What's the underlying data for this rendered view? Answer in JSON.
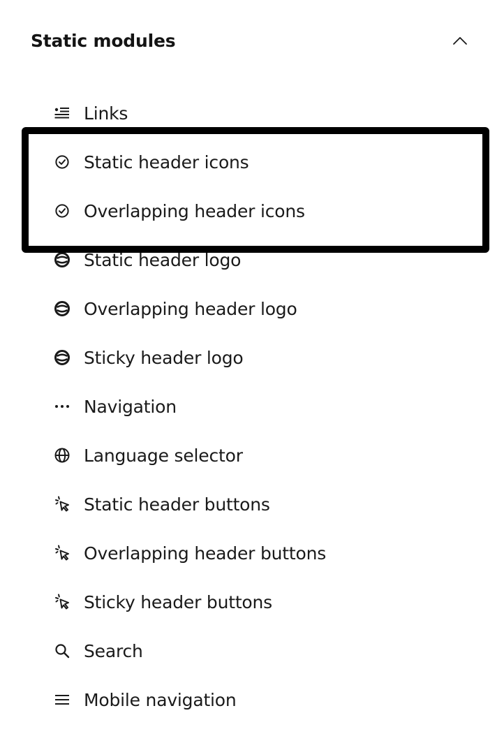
{
  "section": {
    "title": "Static modules",
    "collapse_icon": "chevron-up-icon"
  },
  "modules": [
    {
      "label": "Links",
      "icon": "links-list-icon"
    },
    {
      "label": "Static header icons",
      "icon": "check-circle-icon"
    },
    {
      "label": "Overlapping header icons",
      "icon": "check-circle-icon"
    },
    {
      "label": "Static header logo",
      "icon": "logo-icon"
    },
    {
      "label": "Overlapping header logo",
      "icon": "logo-icon"
    },
    {
      "label": "Sticky header logo",
      "icon": "logo-icon"
    },
    {
      "label": "Navigation",
      "icon": "more-dots-icon"
    },
    {
      "label": "Language selector",
      "icon": "globe-icon"
    },
    {
      "label": "Static header buttons",
      "icon": "cursor-click-icon"
    },
    {
      "label": "Overlapping header buttons",
      "icon": "cursor-click-icon"
    },
    {
      "label": "Sticky header buttons",
      "icon": "cursor-click-icon"
    },
    {
      "label": "Search",
      "icon": "search-icon"
    },
    {
      "label": "Mobile navigation",
      "icon": "hamburger-menu-icon"
    }
  ],
  "highlight": {
    "color": "#000000",
    "covers": [
      "Static header icons",
      "Overlapping header icons"
    ]
  },
  "colors": {
    "text": "#1a1a1a",
    "background": "#ffffff"
  }
}
